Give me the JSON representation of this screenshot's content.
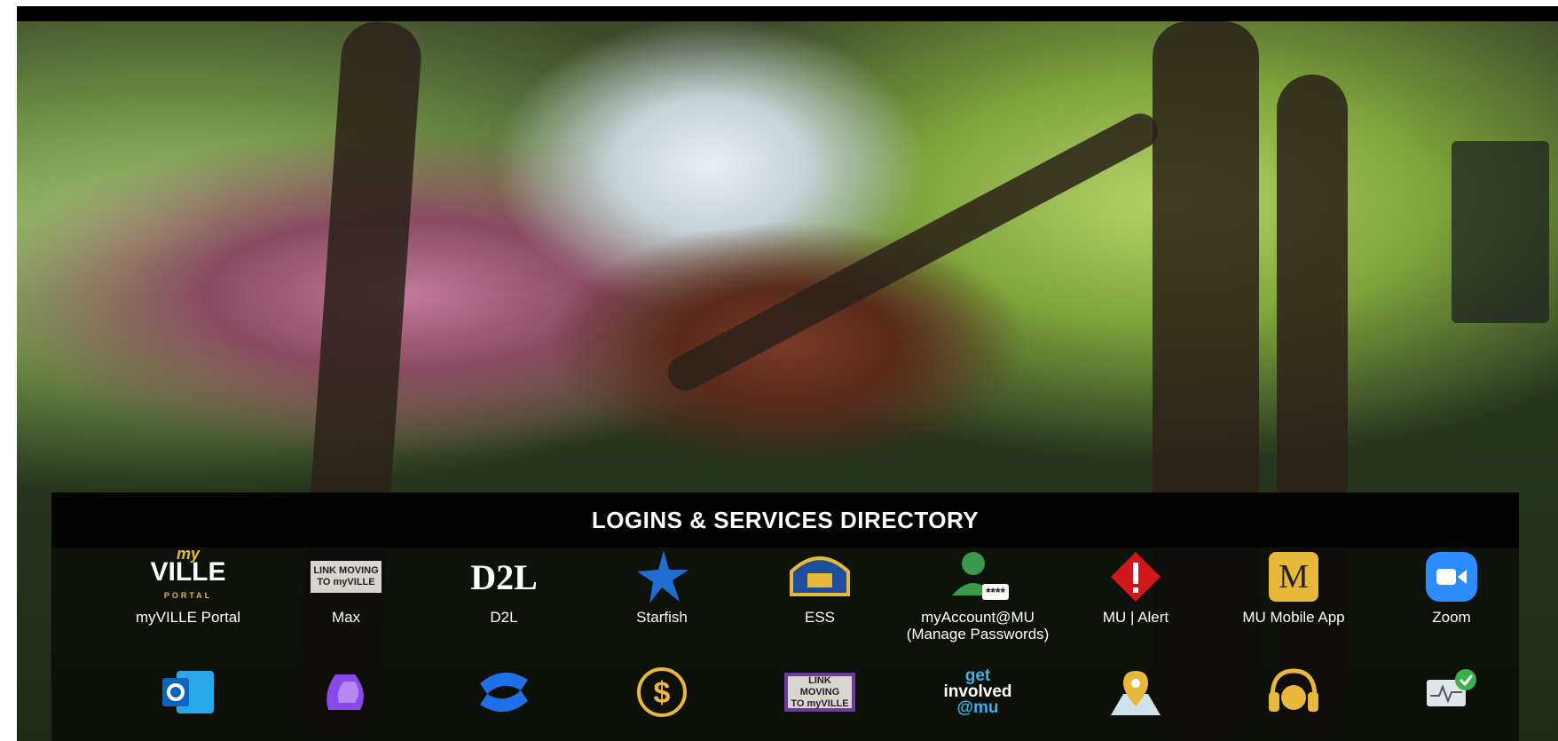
{
  "directory": {
    "title": "LOGINS & SERVICES DIRECTORY",
    "row1": [
      {
        "label": "myVILLE Portal",
        "icon": "myville-portal-icon"
      },
      {
        "label": "Max",
        "icon": "link-moving-max-icon"
      },
      {
        "label": "D2L",
        "icon": "d2l-icon"
      },
      {
        "label": "Starfish",
        "icon": "starfish-icon"
      },
      {
        "label": "ESS",
        "icon": "ess-keystone-icon"
      },
      {
        "label": "myAccount@MU",
        "label2": "(Manage Passwords)",
        "icon": "user-password-icon"
      },
      {
        "label": "MU | Alert",
        "icon": "alert-icon"
      },
      {
        "label": "MU Mobile App",
        "icon": "mu-mobile-app-icon"
      },
      {
        "label": "Zoom",
        "icon": "zoom-camera-icon"
      }
    ],
    "row2": [
      {
        "icon": "outlook-icon"
      },
      {
        "icon": "copilot-icon"
      },
      {
        "icon": "confluence-icon"
      },
      {
        "icon": "dollar-icon"
      },
      {
        "icon": "link-moving-gear-icon"
      },
      {
        "icon": "get-involved-icon"
      },
      {
        "icon": "map-pin-icon"
      },
      {
        "icon": "help-desk-icon"
      },
      {
        "icon": "monitor-check-icon"
      }
    ]
  },
  "brand": {
    "myville_top": "my",
    "myville_mid": "VILLE",
    "myville_bottom": "PORTAL",
    "max_line1": "LINK MOVING",
    "max_line2": "TO myVILLE",
    "d2l_text": "D2L",
    "mu_text": "M",
    "get_line1": "get",
    "get_line2": "involved",
    "get_line3": "@mu",
    "password_mask": "****"
  },
  "colors": {
    "zoom": "#2d8cff",
    "mu_gold": "#e8b83a",
    "alert_red": "#d0181b",
    "starfish_blue": "#1f6fd1"
  }
}
